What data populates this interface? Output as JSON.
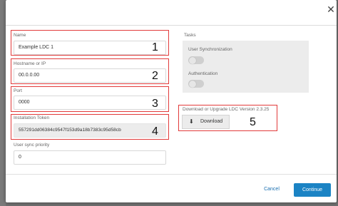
{
  "dialog": {
    "close_icon": "close-icon"
  },
  "form": {
    "name": {
      "label": "Name",
      "value": "Example LDC 1",
      "marker": "1"
    },
    "hostname": {
      "label": "Hostname or IP",
      "value": "00.0.0.00",
      "marker": "2"
    },
    "port": {
      "label": "Port",
      "value": "0000",
      "marker": "3"
    },
    "token": {
      "label": "Installation Token",
      "value": "557291dd06384c9547f153d9a18b7383c95d58cb",
      "marker": "4"
    },
    "sync_priority": {
      "label": "User sync priority",
      "value": "0"
    }
  },
  "tasks": {
    "title": "Tasks",
    "user_sync": {
      "label": "User Synchronization",
      "enabled": false
    },
    "authentication": {
      "label": "Authentication",
      "enabled": false
    }
  },
  "download": {
    "label": "Download or Upgrade LDC Version 2.3.25",
    "button_label": "Download",
    "button_icon": "download-icon",
    "marker": "5"
  },
  "footer": {
    "cancel_label": "Cancel",
    "continue_label": "Continue"
  },
  "colors": {
    "highlight_box": "#e23b3b",
    "primary": "#1b83c4"
  }
}
